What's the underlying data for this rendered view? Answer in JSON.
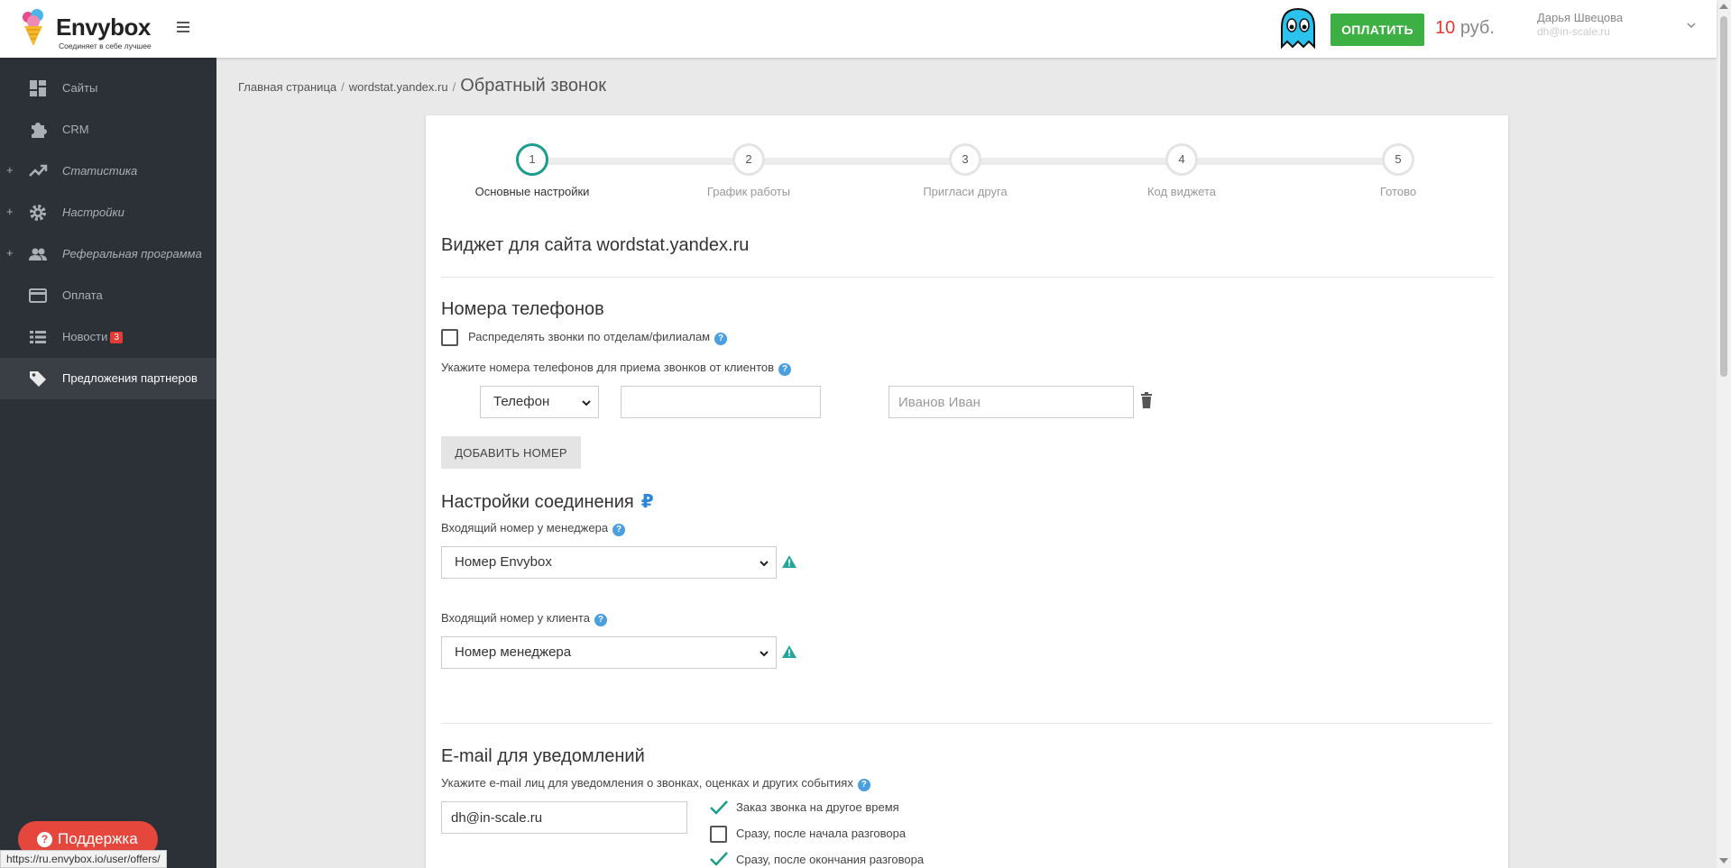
{
  "header": {
    "logo_text": "Envybox",
    "logo_tagline": "Соединяет в себе лучшее",
    "pay_label": "ОПЛАТИТЬ",
    "balance_amount": "10",
    "balance_unit": "руб.",
    "user_name": "Дарья Швецова",
    "user_email": "dh@in-scale.ru"
  },
  "sidebar": {
    "items": [
      {
        "label": "Сайты",
        "icon": "dashboard-icon",
        "expandable": false
      },
      {
        "label": "CRM",
        "icon": "puzzle-icon",
        "expandable": false
      },
      {
        "label": "Статистика",
        "icon": "trending-up-icon",
        "expandable": true
      },
      {
        "label": "Настройки",
        "icon": "gear-icon",
        "expandable": true
      },
      {
        "label": "Реферальная программа",
        "icon": "people-icon",
        "expandable": true
      },
      {
        "label": "Оплата",
        "icon": "credit-card-icon",
        "expandable": false
      },
      {
        "label": "Новости",
        "icon": "list-icon",
        "expandable": false,
        "badge": "3"
      },
      {
        "label": "Предложения партнеров",
        "icon": "tag-icon",
        "expandable": false,
        "active": true
      }
    ],
    "support_label": "Поддержка"
  },
  "status_url": "https://ru.envybox.io/user/offers/",
  "breadcrumb": {
    "home": "Главная страница",
    "site": "wordstat.yandex.ru",
    "current": "Обратный звонок"
  },
  "stepper": {
    "steps": [
      {
        "number": "1",
        "label": "Основные настройки",
        "active": true
      },
      {
        "number": "2",
        "label": "График работы",
        "active": false
      },
      {
        "number": "3",
        "label": "Пригласи друга",
        "active": false
      },
      {
        "number": "4",
        "label": "Код виджета",
        "active": false
      },
      {
        "number": "5",
        "label": "Готово",
        "active": false
      }
    ]
  },
  "form": {
    "widget_title": "Виджет для сайта wordstat.yandex.ru",
    "phones_title": "Номера телефонов",
    "distribute_label": "Распределять звонки по отделам/филиалам",
    "distribute_checked": false,
    "phones_hint": "Укажите номера телефонов для приема звонков от клиентов",
    "phone_type_value": "Телефон",
    "phone_number_value": "",
    "phone_name_placeholder": "Иванов Иван",
    "add_number_label": "ДОБАВИТЬ НОМЕР",
    "connection_title": "Настройки соединения",
    "currency_symbol": "₽",
    "manager_incoming_label": "Входящий номер у менеджера",
    "manager_incoming_value": "Номер Envybox",
    "client_incoming_label": "Входящий номер у клиента",
    "client_incoming_value": "Номер менеджера",
    "email_title": "E-mail для уведомлений",
    "email_hint": "Укажите e-mail лиц для уведомления о звонках, оценках и других событиях",
    "email_value": "dh@in-scale.ru",
    "notify_options": [
      {
        "label": "Заказ звонка на другое время",
        "checked": true
      },
      {
        "label": "Сразу, после начала разговора",
        "checked": false
      },
      {
        "label": "Сразу, после окончания разговора",
        "checked": true
      }
    ]
  },
  "colors": {
    "accent_teal": "#1a9e8c",
    "pay_green": "#3cb043",
    "balance_red": "#e53935",
    "sidebar_bg": "#2c3137",
    "support_red": "#e5473d",
    "help_blue": "#4a9fe0"
  }
}
